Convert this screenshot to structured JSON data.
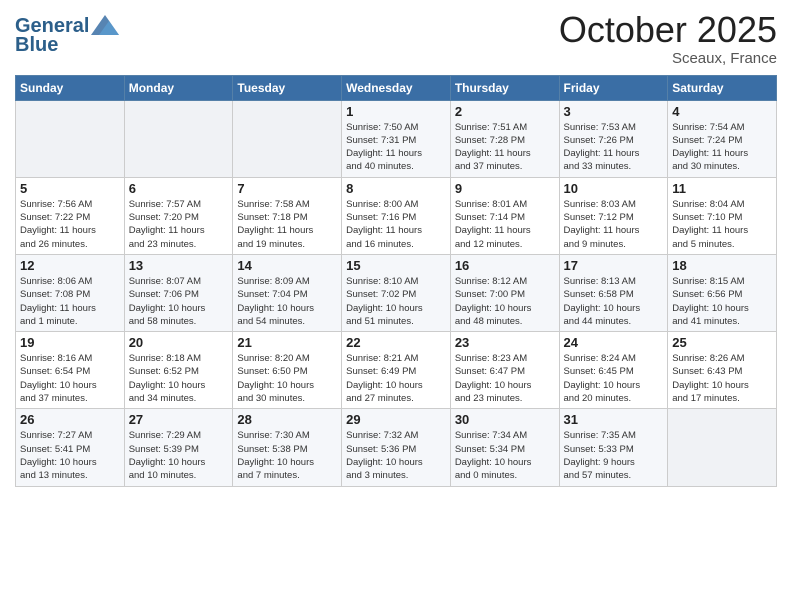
{
  "header": {
    "logo_line1": "General",
    "logo_line2": "Blue",
    "month": "October 2025",
    "location": "Sceaux, France"
  },
  "weekdays": [
    "Sunday",
    "Monday",
    "Tuesday",
    "Wednesday",
    "Thursday",
    "Friday",
    "Saturday"
  ],
  "weeks": [
    [
      {
        "day": "",
        "info": ""
      },
      {
        "day": "",
        "info": ""
      },
      {
        "day": "",
        "info": ""
      },
      {
        "day": "1",
        "info": "Sunrise: 7:50 AM\nSunset: 7:31 PM\nDaylight: 11 hours\nand 40 minutes."
      },
      {
        "day": "2",
        "info": "Sunrise: 7:51 AM\nSunset: 7:28 PM\nDaylight: 11 hours\nand 37 minutes."
      },
      {
        "day": "3",
        "info": "Sunrise: 7:53 AM\nSunset: 7:26 PM\nDaylight: 11 hours\nand 33 minutes."
      },
      {
        "day": "4",
        "info": "Sunrise: 7:54 AM\nSunset: 7:24 PM\nDaylight: 11 hours\nand 30 minutes."
      }
    ],
    [
      {
        "day": "5",
        "info": "Sunrise: 7:56 AM\nSunset: 7:22 PM\nDaylight: 11 hours\nand 26 minutes."
      },
      {
        "day": "6",
        "info": "Sunrise: 7:57 AM\nSunset: 7:20 PM\nDaylight: 11 hours\nand 23 minutes."
      },
      {
        "day": "7",
        "info": "Sunrise: 7:58 AM\nSunset: 7:18 PM\nDaylight: 11 hours\nand 19 minutes."
      },
      {
        "day": "8",
        "info": "Sunrise: 8:00 AM\nSunset: 7:16 PM\nDaylight: 11 hours\nand 16 minutes."
      },
      {
        "day": "9",
        "info": "Sunrise: 8:01 AM\nSunset: 7:14 PM\nDaylight: 11 hours\nand 12 minutes."
      },
      {
        "day": "10",
        "info": "Sunrise: 8:03 AM\nSunset: 7:12 PM\nDaylight: 11 hours\nand 9 minutes."
      },
      {
        "day": "11",
        "info": "Sunrise: 8:04 AM\nSunset: 7:10 PM\nDaylight: 11 hours\nand 5 minutes."
      }
    ],
    [
      {
        "day": "12",
        "info": "Sunrise: 8:06 AM\nSunset: 7:08 PM\nDaylight: 11 hours\nand 1 minute."
      },
      {
        "day": "13",
        "info": "Sunrise: 8:07 AM\nSunset: 7:06 PM\nDaylight: 10 hours\nand 58 minutes."
      },
      {
        "day": "14",
        "info": "Sunrise: 8:09 AM\nSunset: 7:04 PM\nDaylight: 10 hours\nand 54 minutes."
      },
      {
        "day": "15",
        "info": "Sunrise: 8:10 AM\nSunset: 7:02 PM\nDaylight: 10 hours\nand 51 minutes."
      },
      {
        "day": "16",
        "info": "Sunrise: 8:12 AM\nSunset: 7:00 PM\nDaylight: 10 hours\nand 48 minutes."
      },
      {
        "day": "17",
        "info": "Sunrise: 8:13 AM\nSunset: 6:58 PM\nDaylight: 10 hours\nand 44 minutes."
      },
      {
        "day": "18",
        "info": "Sunrise: 8:15 AM\nSunset: 6:56 PM\nDaylight: 10 hours\nand 41 minutes."
      }
    ],
    [
      {
        "day": "19",
        "info": "Sunrise: 8:16 AM\nSunset: 6:54 PM\nDaylight: 10 hours\nand 37 minutes."
      },
      {
        "day": "20",
        "info": "Sunrise: 8:18 AM\nSunset: 6:52 PM\nDaylight: 10 hours\nand 34 minutes."
      },
      {
        "day": "21",
        "info": "Sunrise: 8:20 AM\nSunset: 6:50 PM\nDaylight: 10 hours\nand 30 minutes."
      },
      {
        "day": "22",
        "info": "Sunrise: 8:21 AM\nSunset: 6:49 PM\nDaylight: 10 hours\nand 27 minutes."
      },
      {
        "day": "23",
        "info": "Sunrise: 8:23 AM\nSunset: 6:47 PM\nDaylight: 10 hours\nand 23 minutes."
      },
      {
        "day": "24",
        "info": "Sunrise: 8:24 AM\nSunset: 6:45 PM\nDaylight: 10 hours\nand 20 minutes."
      },
      {
        "day": "25",
        "info": "Sunrise: 8:26 AM\nSunset: 6:43 PM\nDaylight: 10 hours\nand 17 minutes."
      }
    ],
    [
      {
        "day": "26",
        "info": "Sunrise: 7:27 AM\nSunset: 5:41 PM\nDaylight: 10 hours\nand 13 minutes."
      },
      {
        "day": "27",
        "info": "Sunrise: 7:29 AM\nSunset: 5:39 PM\nDaylight: 10 hours\nand 10 minutes."
      },
      {
        "day": "28",
        "info": "Sunrise: 7:30 AM\nSunset: 5:38 PM\nDaylight: 10 hours\nand 7 minutes."
      },
      {
        "day": "29",
        "info": "Sunrise: 7:32 AM\nSunset: 5:36 PM\nDaylight: 10 hours\nand 3 minutes."
      },
      {
        "day": "30",
        "info": "Sunrise: 7:34 AM\nSunset: 5:34 PM\nDaylight: 10 hours\nand 0 minutes."
      },
      {
        "day": "31",
        "info": "Sunrise: 7:35 AM\nSunset: 5:33 PM\nDaylight: 9 hours\nand 57 minutes."
      },
      {
        "day": "",
        "info": ""
      }
    ]
  ]
}
